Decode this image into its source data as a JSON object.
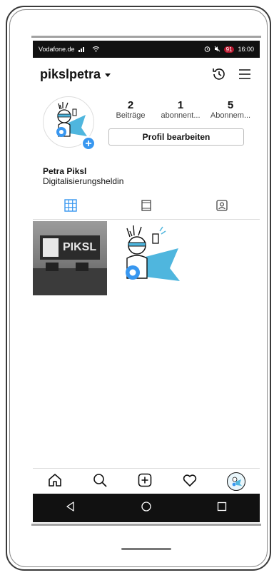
{
  "status_bar": {
    "carrier": "Vodafone.de",
    "battery": "91",
    "time": "16:00"
  },
  "header": {
    "username": "pikslpetra"
  },
  "profile": {
    "stats": [
      {
        "value": "2",
        "label": "Beiträge"
      },
      {
        "value": "1",
        "label": "abonnent..."
      },
      {
        "value": "5",
        "label": "Abonnem..."
      }
    ],
    "edit_button": "Profil bearbeiten",
    "name": "Petra Piksl",
    "bio": "Digitalisierungsheldin"
  },
  "posts": {
    "office_sign_text": "PIKSL"
  },
  "colors": {
    "accent_blue": "#3897f0",
    "hero_cape": "#4fb6de",
    "battery_red": "#b5142b"
  },
  "icons": {
    "header": [
      "history-icon",
      "menu-icon"
    ],
    "tabs": [
      "grid-icon",
      "feed-icon",
      "tagged-icon"
    ],
    "bottom_nav": [
      "home-icon",
      "search-icon",
      "add-icon",
      "heart-icon",
      "profile-icon"
    ],
    "android": [
      "back-icon",
      "home-circle-icon",
      "recents-icon"
    ]
  }
}
